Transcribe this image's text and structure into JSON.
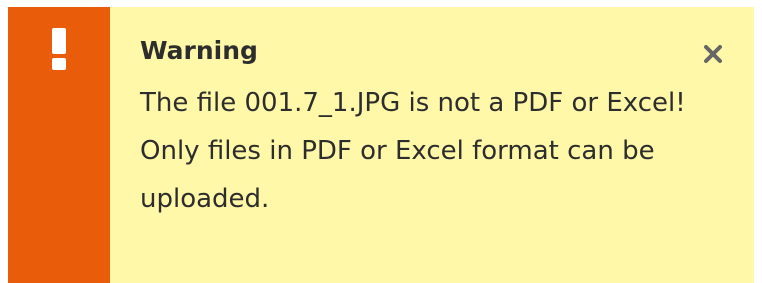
{
  "notification": {
    "icon": "exclamation-icon",
    "title": "Warning",
    "message": "The file 001.7_1.JPG is not a PDF or Excel! Only files in PDF or Excel format can be uploaded.",
    "close_icon": "close-icon",
    "accent_color": "#e85c0a",
    "background_color": "#fff8a8"
  }
}
